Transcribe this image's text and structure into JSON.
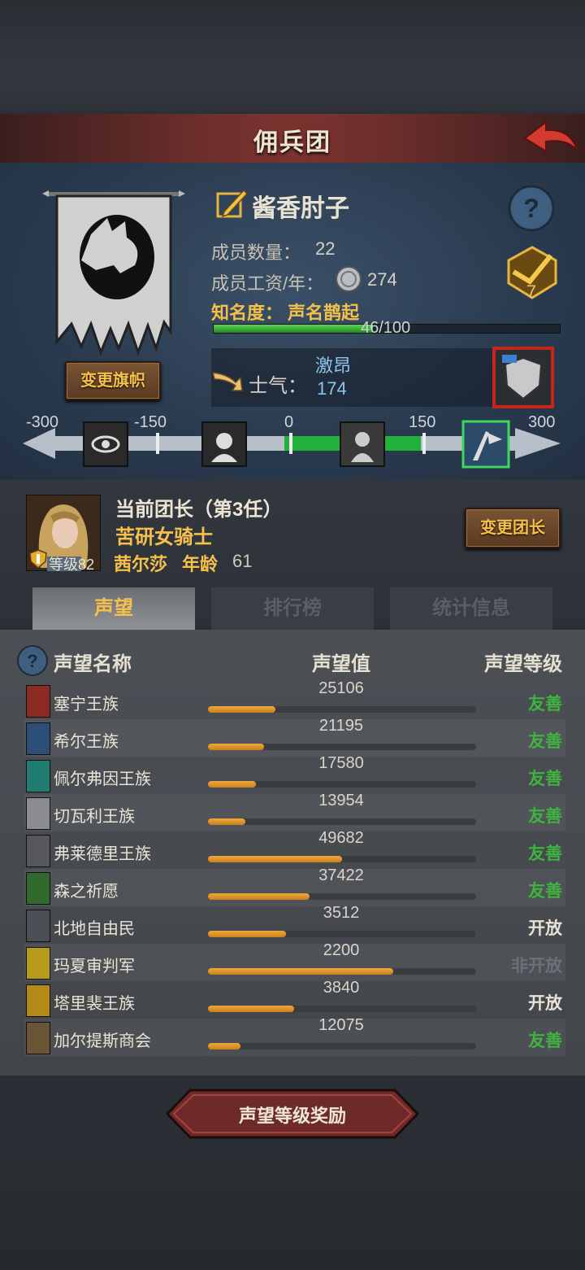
{
  "header": {
    "title": "佣兵团"
  },
  "banner": {
    "change_label": "变更旗帜"
  },
  "mercenary": {
    "name": "酱香肘子",
    "member_count_label": "成员数量：",
    "member_count": "22",
    "salary_label": "成员工资/年：",
    "salary": "274",
    "fame_label": "知名度：",
    "fame_title": "声名鹊起",
    "fame_text": "46/100",
    "fame_progress": 0.46,
    "badge_count": "7"
  },
  "morale": {
    "label": "士气：",
    "state": "激昂",
    "value": "174",
    "scale": [
      "-300",
      "-150",
      "0",
      "150",
      "300"
    ],
    "value_numeric": 174
  },
  "leader": {
    "title": "当前团长（第3任）",
    "class": "苦研女骑士",
    "level_label": "等级82",
    "name": "茜尔莎",
    "age_label": "年龄",
    "age": "61",
    "change_label": "变更团长"
  },
  "tabs": [
    {
      "label": "声望",
      "active": true
    },
    {
      "label": "排行榜",
      "active": false
    },
    {
      "label": "统计信息",
      "active": false
    }
  ],
  "reputation": {
    "headers": {
      "name": "声望名称",
      "value": "声望值",
      "level": "声望等级"
    },
    "rows": [
      {
        "name": "塞宁王族",
        "value": "25106",
        "level": "友善",
        "fill": 0.25,
        "icon": "red-dragon-crest-icon",
        "color": "#8b2a22"
      },
      {
        "name": "希尔王族",
        "value": "21195",
        "level": "友善",
        "fill": 0.21,
        "icon": "blue-knight-crest-icon",
        "color": "#2d4e78"
      },
      {
        "name": "佩尔弗因王族",
        "value": "17580",
        "level": "友善",
        "fill": 0.18,
        "icon": "teal-wave-crest-icon",
        "color": "#1f7d72"
      },
      {
        "name": "切瓦利王族",
        "value": "13954",
        "level": "友善",
        "fill": 0.14,
        "icon": "white-scales-crest-icon",
        "color": "#8a8c8f"
      },
      {
        "name": "弗莱德里王族",
        "value": "49682",
        "level": "友善",
        "fill": 0.5,
        "icon": "grey-wolf-crest-icon",
        "color": "#55575a"
      },
      {
        "name": "森之祈愿",
        "value": "37422",
        "level": "友善",
        "fill": 0.38,
        "icon": "green-tree-crest-icon",
        "color": "#2f6a2c"
      },
      {
        "name": "北地自由民",
        "value": "3512",
        "level": "开放",
        "fill": 0.29,
        "icon": "grey-axe-crest-icon",
        "color": "#4b4f55"
      },
      {
        "name": "玛夏审判军",
        "value": "2200",
        "level": "非开放",
        "fill": 0.69,
        "icon": "yellow-cross-crest-icon",
        "color": "#b89a1c"
      },
      {
        "name": "塔里裴王族",
        "value": "3840",
        "level": "开放",
        "fill": 0.32,
        "icon": "yellow-flame-crest-icon",
        "color": "#b48a16"
      },
      {
        "name": "加尔提斯商会",
        "value": "12075",
        "level": "友善",
        "fill": 0.12,
        "icon": "chest-crest-icon",
        "color": "#6a5436"
      }
    ]
  },
  "level_colors": {
    "友善": "#3fb23f",
    "开放": "#e9e3d5",
    "非开放": "#6c7078"
  },
  "reward_button": {
    "label": "声望等级奖励"
  }
}
